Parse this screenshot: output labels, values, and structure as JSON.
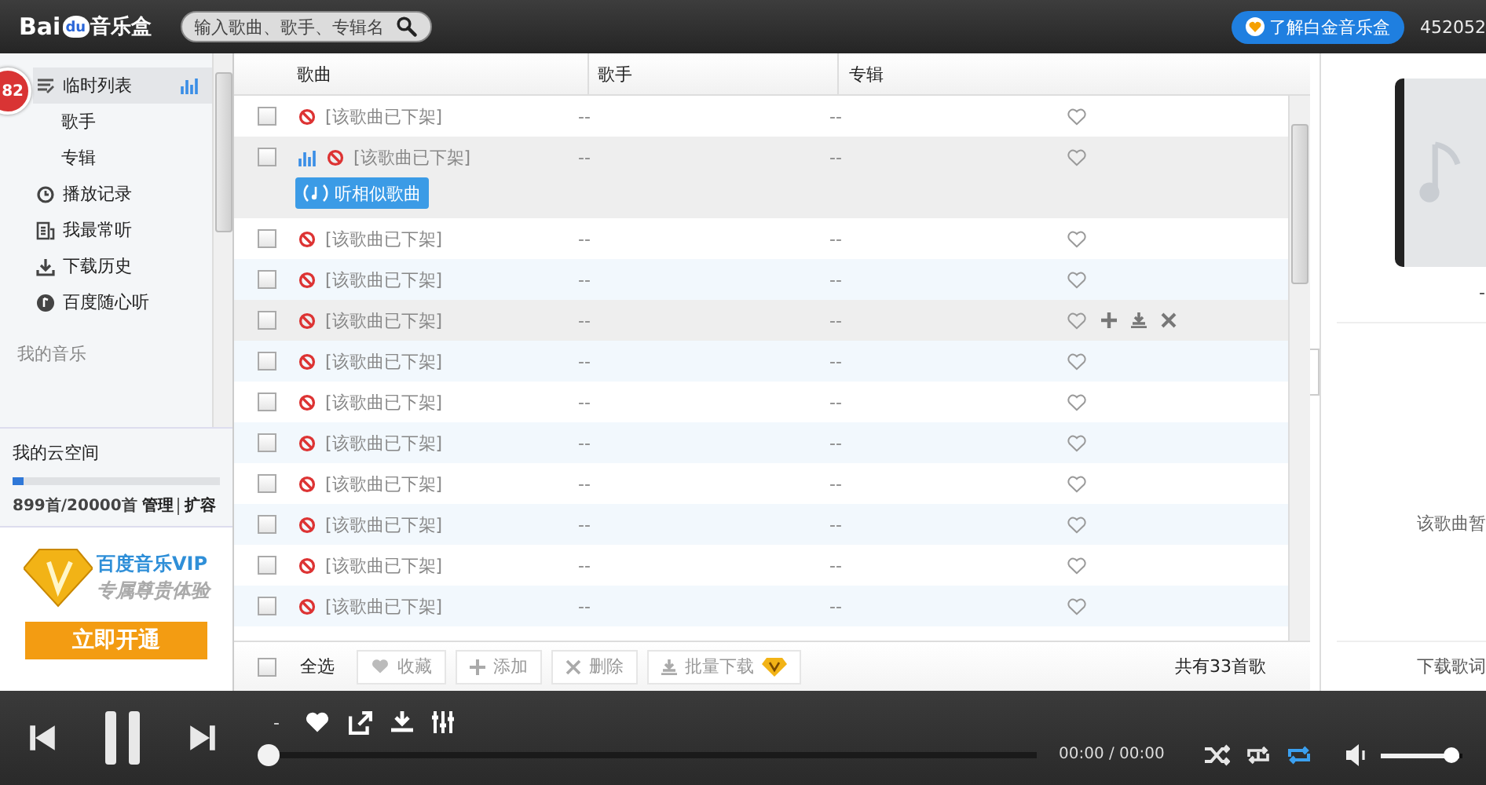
{
  "top_bar": {
    "logo": {
      "left": "Bai",
      "paw": "du",
      "right": "音乐盒"
    },
    "search": {
      "placeholder": "输入歌曲、歌手、专辑名"
    },
    "promo_button": "了解白金音乐盒",
    "user": "452052"
  },
  "sidebar": {
    "badge": "82",
    "items": [
      {
        "label": "临时列表",
        "kind": "list",
        "selected": true,
        "playing": true,
        "children": [
          {
            "label": "歌手",
            "selected": false
          },
          {
            "label": "专辑",
            "selected": false
          }
        ]
      },
      {
        "label": "播放记录",
        "kind": "history",
        "selected": false,
        "playing": false
      },
      {
        "label": "我最常听",
        "kind": "frequent",
        "selected": false,
        "playing": false
      },
      {
        "label": "下载历史",
        "kind": "download",
        "selected": false,
        "playing": false
      },
      {
        "label": "百度随心听",
        "kind": "radio",
        "selected": false,
        "playing": false
      }
    ],
    "section": "我的音乐",
    "cloud": {
      "title": "我的云空间",
      "level": 0.05,
      "usage": "899首/20000首",
      "links": [
        "管理",
        "扩容"
      ]
    },
    "vip": {
      "title": "百度音乐VIP",
      "subtitle": "专属尊贵体验",
      "button": "立即开通"
    }
  },
  "table": {
    "columns": [
      "歌曲",
      "歌手",
      "专辑"
    ],
    "rows": [
      {
        "checked": false,
        "title": "[该歌曲已下架]",
        "singer": "--",
        "album": "--",
        "playing": false,
        "hovered": false
      },
      {
        "checked": false,
        "title": "[该歌曲已下架]",
        "singer": "--",
        "album": "--",
        "playing": true,
        "hovered": false,
        "similar_button": "听相似歌曲"
      },
      {
        "checked": false,
        "title": "[该歌曲已下架]",
        "singer": "--",
        "album": "--",
        "playing": false,
        "hovered": false
      },
      {
        "checked": false,
        "title": "[该歌曲已下架]",
        "singer": "--",
        "album": "--",
        "playing": false,
        "hovered": false
      },
      {
        "checked": false,
        "title": "[该歌曲已下架]",
        "singer": "--",
        "album": "--",
        "playing": false,
        "hovered": true
      },
      {
        "checked": false,
        "title": "[该歌曲已下架]",
        "singer": "--",
        "album": "--",
        "playing": false,
        "hovered": false
      },
      {
        "checked": false,
        "title": "[该歌曲已下架]",
        "singer": "--",
        "album": "--",
        "playing": false,
        "hovered": false
      },
      {
        "checked": false,
        "title": "[该歌曲已下架]",
        "singer": "--",
        "album": "--",
        "playing": false,
        "hovered": false
      },
      {
        "checked": false,
        "title": "[该歌曲已下架]",
        "singer": "--",
        "album": "--",
        "playing": false,
        "hovered": false
      },
      {
        "checked": false,
        "title": "[该歌曲已下架]",
        "singer": "--",
        "album": "--",
        "playing": false,
        "hovered": false
      },
      {
        "checked": false,
        "title": "[该歌曲已下架]",
        "singer": "--",
        "album": "--",
        "playing": false,
        "hovered": false
      },
      {
        "checked": false,
        "title": "[该歌曲已下架]",
        "singer": "--",
        "album": "--",
        "playing": false,
        "hovered": false
      }
    ],
    "footer": {
      "select_all": {
        "label": "全选",
        "checked": false
      },
      "buttons": [
        {
          "label": "收藏",
          "kind": "heart",
          "vip": false
        },
        {
          "label": "添加",
          "kind": "add",
          "vip": false
        },
        {
          "label": "删除",
          "kind": "delete",
          "vip": false
        },
        {
          "label": "批量下载",
          "kind": "download",
          "vip": true
        }
      ],
      "count": "共有33首歌"
    }
  },
  "right_panel": {
    "artist": "-",
    "lyrics_message": "该歌曲暂",
    "links": [
      "下载歌词"
    ]
  },
  "player": {
    "title": "-",
    "progress": {
      "level": 0
    },
    "time": "00:00 / 00:00",
    "modes": [
      {
        "kind": "shuffle",
        "selected": false
      },
      {
        "kind": "repeat-one",
        "selected": false
      },
      {
        "kind": "repeat-all",
        "selected": true
      }
    ],
    "volume": {
      "level": 0.95
    }
  }
}
